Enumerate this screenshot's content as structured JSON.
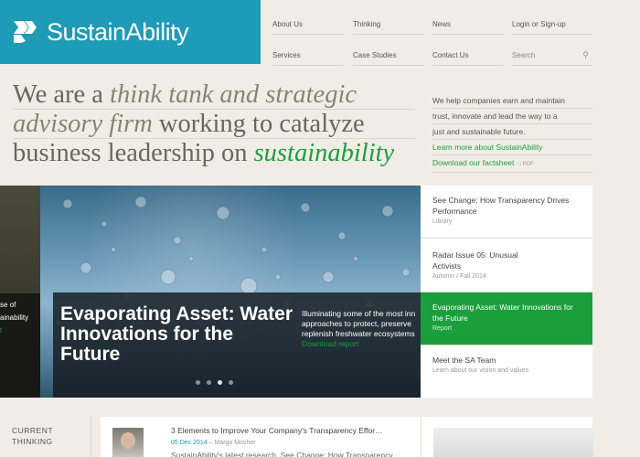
{
  "brand": {
    "name": "SustainAbility",
    "color": "#1d9bb7",
    "accent": "#1a9f3d"
  },
  "nav": {
    "about": "About Us",
    "thinking": "Thinking",
    "news": "News",
    "login": "Login or Sign-up",
    "services": "Services",
    "case_studies": "Case Studies",
    "contact": "Contact Us",
    "search_placeholder": "Search"
  },
  "headline": {
    "p1": "We are a ",
    "p2": "think tank and strategic",
    "p3": "advisory firm",
    "p4": " working to catalyze",
    "p5": "business leadership on ",
    "p6": "sustainability"
  },
  "intro": {
    "line1": "We help companies earn and maintain",
    "line2": "trust, innovate and lead the way to a",
    "line3": "just and sustainable future.",
    "learn_more": "Learn more about SustainAbility",
    "factsheet": "Download our factsheet",
    "pdf": "PDF"
  },
  "hero": {
    "left_line1": "se of",
    "left_line2": "ainability",
    "left_line3": "t",
    "title": "Evaporating Asset: Water Innovations for the Future",
    "desc1": "Illuminating some of the most inn",
    "desc2": "approaches to protect, preserve",
    "desc3": "replenish freshwater ecosystems",
    "link": "Download report",
    "slides_total": 4,
    "slides_active": 3
  },
  "side": [
    {
      "title": "See Change: How Transparency Drives Performance",
      "sub": "Library"
    },
    {
      "title": "Radar Issue 05: Unusual Activists",
      "sub": "Autumn / Fall 2014"
    },
    {
      "title": "Evaporating Asset: Water Innovations for the Future",
      "sub": "Report"
    },
    {
      "title": "Meet the SA Team",
      "sub": "Learn about our vision and values"
    }
  ],
  "current": {
    "label1": "CURRENT",
    "label2": "THINKING"
  },
  "card": {
    "title": "3 Elements to Improve Your Company's Transparency Effor…",
    "date": "05 Dec 2014",
    "author": " – Margo Mosher",
    "snippet": "SustainAbility's latest research, See Change: How Transparency"
  }
}
